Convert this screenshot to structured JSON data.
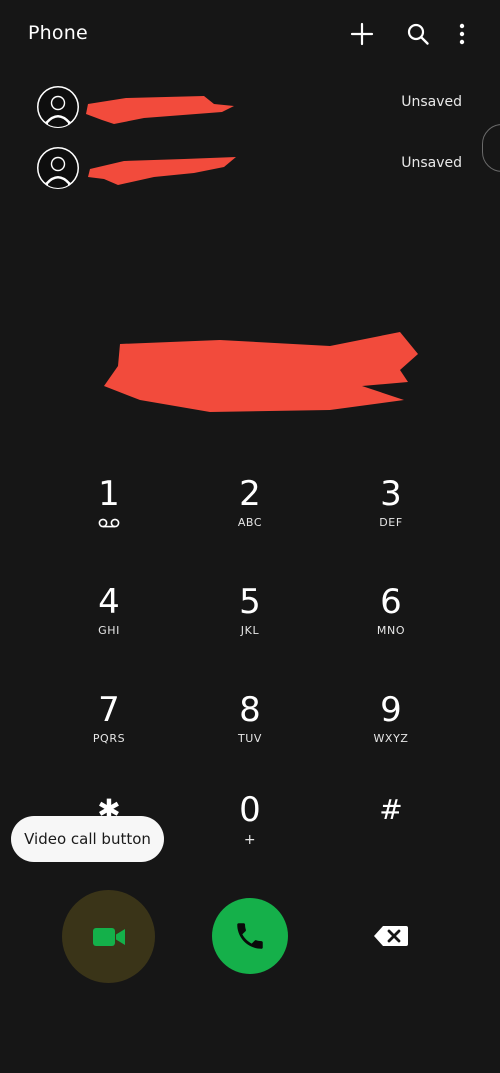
{
  "header": {
    "title": "Phone",
    "icons": [
      "add-icon",
      "search-icon",
      "more-options-icon"
    ]
  },
  "suggestions": [
    {
      "status": "Unsaved"
    },
    {
      "status": "Unsaved"
    }
  ],
  "keypad": [
    {
      "digit": "1",
      "letters": "",
      "icon": "voicemail-icon"
    },
    {
      "digit": "2",
      "letters": "ABC"
    },
    {
      "digit": "3",
      "letters": "DEF"
    },
    {
      "digit": "4",
      "letters": "GHI"
    },
    {
      "digit": "5",
      "letters": "JKL"
    },
    {
      "digit": "6",
      "letters": "MNO"
    },
    {
      "digit": "7",
      "letters": "PQRS"
    },
    {
      "digit": "8",
      "letters": "TUV"
    },
    {
      "digit": "9",
      "letters": "WXYZ"
    },
    {
      "digit": "✱",
      "letters": ""
    },
    {
      "digit": "0",
      "letters": "+"
    },
    {
      "digit": "#",
      "letters": ""
    }
  ],
  "tooltip": {
    "text": "Video call button"
  },
  "colors": {
    "background": "#161616",
    "call_green": "#15b04a",
    "video_green": "#14b04a",
    "video_bg": "#3a3418",
    "redaction": "#f24b3c"
  }
}
